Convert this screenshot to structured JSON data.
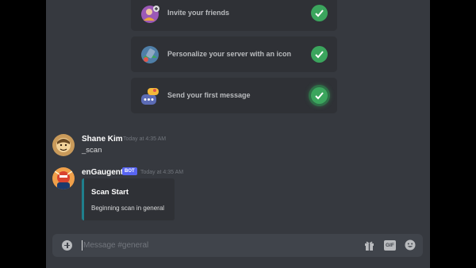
{
  "checklist": [
    {
      "label": "Invite your friends",
      "icon": "invite-friends-icon"
    },
    {
      "label": "Personalize your server with an icon",
      "icon": "personalize-server-icon"
    },
    {
      "label": "Send your first message",
      "icon": "first-message-icon"
    }
  ],
  "messages": [
    {
      "author": "Shane Kim",
      "timestamp": "Today at 4:35 AM",
      "text": "_scan"
    },
    {
      "author": "enGaugent",
      "bot_tag": "BOT",
      "timestamp": "Today at 4:35 AM",
      "embed": {
        "title": "Scan Start",
        "description": "Beginning scan in general",
        "accent": "#1f7f8c"
      }
    }
  ],
  "composer": {
    "placeholder": "Message #general",
    "gif_label": "GIF"
  },
  "colors": {
    "complete": "#3ba55d",
    "bot_badge": "#5865f2",
    "background": "#36393f",
    "card": "#2f3136"
  }
}
